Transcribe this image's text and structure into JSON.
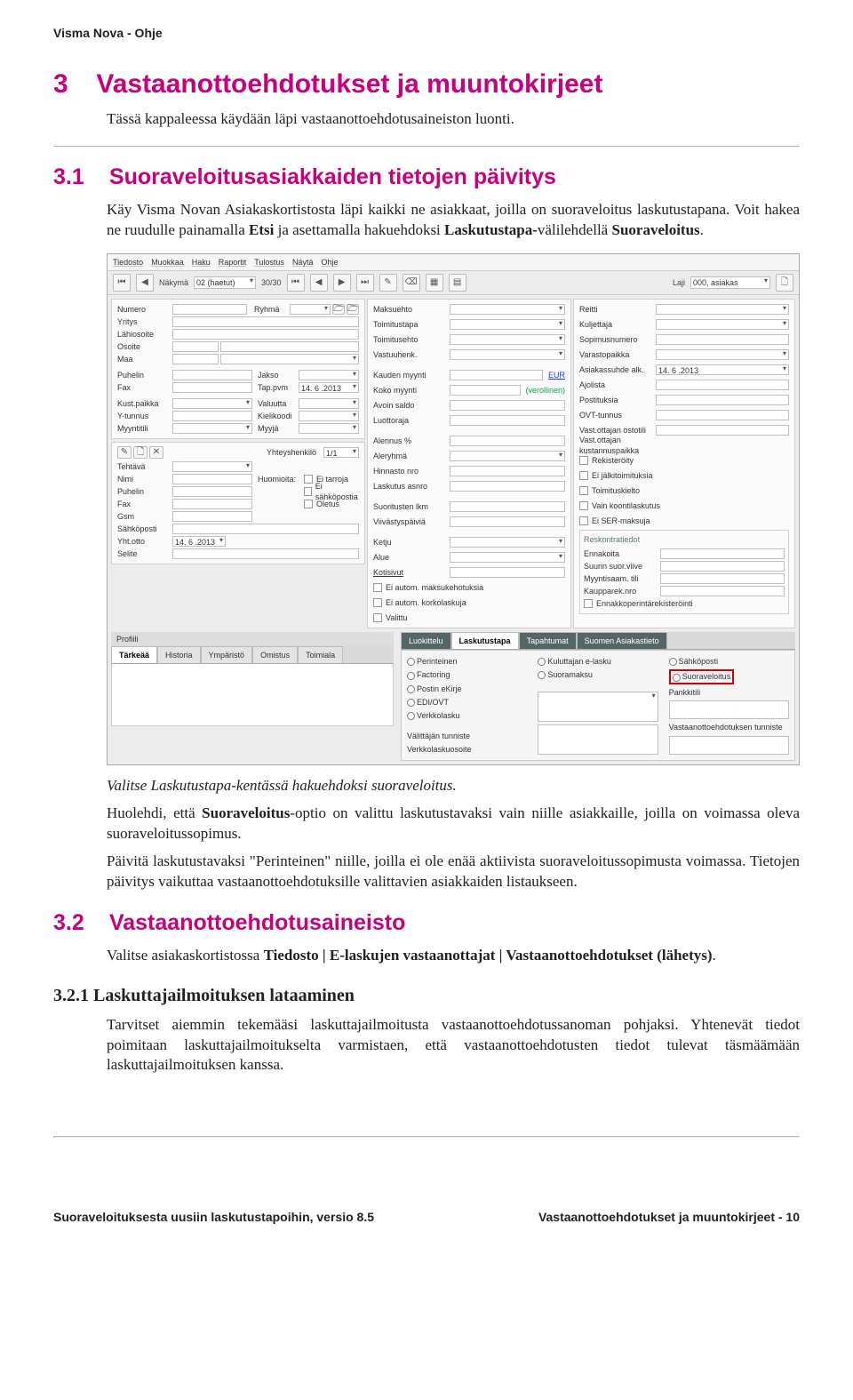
{
  "header": {
    "doc_title": "Visma Nova - Ohje"
  },
  "chapter": {
    "num": "3",
    "title": "Vastaanottoehdotukset ja muuntokirjeet",
    "intro": "Tässä kappaleessa käydään läpi vastaanottoehdotusaineiston luonti."
  },
  "section_3_1": {
    "num": "3.1",
    "title": "Suoraveloitusasiakkaiden tietojen päivitys",
    "p1a": "Käy Visma Novan Asiakaskortistosta läpi kaikki ne asiakkaat, joilla on suoraveloitus laskutustapana. Voit hakea ne ruudulle painamalla ",
    "p1b": "Etsi",
    "p1c": " ja asettamalla hakuehdoksi ",
    "p1d": "Laskutustapa-",
    "p1e": "välilehdellä ",
    "p1f": "Suoraveloitus",
    "p1g": ".",
    "caption1": "Valitse Laskutustapa-kentässä hakuehdoksi suoraveloitus.",
    "p2a": "Huolehdi, että ",
    "p2b": "Suoraveloitus",
    "p2c": "-optio on valittu laskutustavaksi vain niille asiakkaille, joilla on voimassa oleva suoraveloitussopimus.",
    "p3": "Päivitä laskutustavaksi \"Perinteinen\" niille, joilla ei ole enää aktiivista suoraveloitussopimusta voimassa. Tietojen päivitys vaikuttaa vastaanottoehdotuksille valittavien asiakkaiden listaukseen."
  },
  "section_3_2": {
    "num": "3.2",
    "title": "Vastaanottoehdotusaineisto",
    "p1a": "Valitse asiakaskortistossa ",
    "p1b": "Tiedosto | E-laskujen vastaanottajat | Vastaanottoehdotukset (lähetys)",
    "p1c": "."
  },
  "section_3_2_1": {
    "num": "3.2.1",
    "title": "Laskuttajailmoituksen lataaminen",
    "p1": "Tarvitset aiemmin tekemääsi laskuttajailmoitusta vastaanottoehdotussanoman pohjaksi. Yhtenevät tiedot poimitaan laskuttajailmoitukselta varmistaen, että vastaanottoehdotusten tiedot tulevat täsmäämään laskuttajailmoituksen kanssa."
  },
  "footer": {
    "left": "Suoraveloituksesta uusiin laskutustapoihin, versio 8.5",
    "right": "Vastaanottoehdotukset ja muuntokirjeet - 10"
  },
  "screenshot": {
    "menu": [
      "Tiedosto",
      "Muokkaa",
      "Haku",
      "Raportit",
      "Tulostus",
      "Näytä",
      "Ohje"
    ],
    "toolbar": {
      "nakyma": "Näkymä",
      "nakyma_val": "02 (haetut)",
      "count": "30/30",
      "laji_label": "Laji",
      "laji_val": "000, asiakas"
    },
    "colA": {
      "labels": [
        "Numero",
        "Yritys",
        "Lähiosoite",
        "Osoite",
        "Maa",
        "Puhelin",
        "Fax",
        "Kust.paikka",
        "Y-tunnus",
        "Myyntitili"
      ],
      "ryhma": "Ryhmä",
      "jakso": "Jakso",
      "tap": "Tap.pvm",
      "tap_date": "14. 6 .2013",
      "valuutta": "Valuutta",
      "kielikoodi": "Kielikoodi",
      "myyja": "Myyjä",
      "tehtava": "Tehtävä",
      "nimi": "Nimi",
      "puhelin2": "Puhelin",
      "fax2": "Fax",
      "gsm": "Gsm",
      "sahkoposti": "Sähköposti",
      "yhtotto": "Yht.otto",
      "yhtotto_date": "14. 6 .2013",
      "selite": "Selite",
      "yhteyshenkilo": "Yhteyshenkilö",
      "yh_count": "1/1",
      "huomioita": "Huomioita:",
      "chk1": "Ei tarroja",
      "chk2": "Ei sähköpostia",
      "chk3": "Oletus"
    },
    "colB": {
      "labels": [
        "Maksuehto",
        "Toimitustapa",
        "Toimitusehto",
        "Vastuuhenk."
      ],
      "kauden": "Kauden myynti",
      "koko": "Koko myynti",
      "eur": "EUR",
      "veroll": "(verollinen)",
      "avoin": "Avoin saldo",
      "luottoraja": "Luottoraja",
      "alennus": "Alennus %",
      "aleryhma": "Aleryhmä",
      "hinnasto": "Hinnasto nro",
      "laskas": "Laskutus asnro",
      "suorit": "Suoritusten lkm",
      "viivastys": "Viivästyspäiviä",
      "ketju": "Ketju",
      "alue": "Alue",
      "kotisivut": "Kotisivut",
      "chk1": "Ei autom. maksukehotuksia",
      "chk2": "Ei autom. korkolaskuja",
      "chk3": "Valittu"
    },
    "colC": {
      "labels": [
        "Reitti",
        "Kuljettaja",
        "Sopimusnumero",
        "Varastopaikka"
      ],
      "ask_alk": "Asiakassuhde alk.",
      "ask_date": "14. 6 .2013",
      "ajolista": "Ajolista",
      "postituksia": "Postituksia",
      "ovt": "OVT-tunnus",
      "vost": "Vast.ottajan ostotili",
      "vkust": "Vast.ottajan kustannuspaikka",
      "chk1": "Rekisteröity",
      "chk2": "Ei jälkitoimituksia",
      "chk3": "Toimituskielto",
      "chk4": "Vain koontilaskutus",
      "chk5": "Ei SER-maksuja",
      "reskontra": "Reskontratiedot",
      "ennakoita": "Ennakoita",
      "suurin": "Suurin suor.viive",
      "myyntis": "Myyntisaam. tili",
      "kaupparek": "Kaupparek.nro",
      "chk6": "Ennakkoperintärekisteröinti"
    },
    "tabs_left": [
      "Tärkeää",
      "Historia",
      "Ympäristö",
      "Omistus",
      "Toimiala"
    ],
    "profili": "Profiili",
    "tabs_right": [
      "Luokittelu",
      "Laskutustapa",
      "Tapahtumat",
      "Suomen Asiakastieto"
    ],
    "lask": {
      "col1": [
        "Perinteinen",
        "Factoring",
        "Postin eKirje",
        "EDI/OVT",
        "Verkkolasku"
      ],
      "col2": [
        "Kuluttajan e-lasku",
        "Suoramaksu"
      ],
      "valittajan": "Välittäjän tunniste",
      "verkko": "Verkkolaskuosoite",
      "col3a": "Sähköposti",
      "col3b": "Suoraveloitus",
      "pankki": "Pankkitili",
      "vast": "Vastaanottoehdotuksen tunniste"
    }
  }
}
